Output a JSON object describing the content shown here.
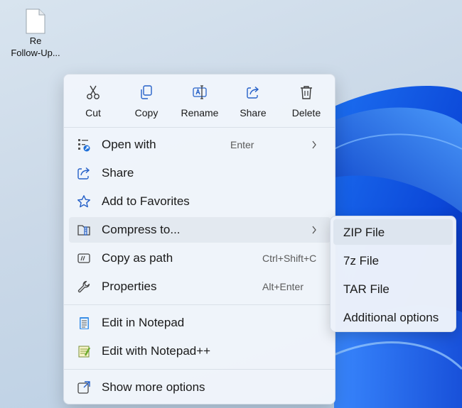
{
  "desktop": {
    "file_icon": {
      "label_line1": "Re",
      "label_line2": "Follow-Up..."
    }
  },
  "context_menu": {
    "quick_actions": [
      {
        "label": "Cut",
        "icon": "scissors-icon"
      },
      {
        "label": "Copy",
        "icon": "copy-icon"
      },
      {
        "label": "Rename",
        "icon": "rename-icon"
      },
      {
        "label": "Share",
        "icon": "share-icon"
      },
      {
        "label": "Delete",
        "icon": "trash-icon"
      }
    ],
    "items": [
      {
        "label": "Open with",
        "accelerator": "Enter",
        "has_submenu": true,
        "icon": "open-with-icon"
      },
      {
        "label": "Share",
        "accelerator": "",
        "icon": "share-icon"
      },
      {
        "label": "Add to Favorites",
        "accelerator": "",
        "icon": "star-icon"
      },
      {
        "label": "Compress to...",
        "accelerator": "",
        "has_submenu": true,
        "icon": "zip-folder-icon",
        "highlighted": true
      },
      {
        "label": "Copy as path",
        "accelerator": "Ctrl+Shift+C",
        "icon": "copy-path-icon"
      },
      {
        "label": "Properties",
        "accelerator": "Alt+Enter",
        "icon": "wrench-icon"
      },
      {
        "label": "Edit in Notepad",
        "accelerator": "",
        "icon": "notepad-icon"
      },
      {
        "label": "Edit with Notepad++",
        "accelerator": "",
        "icon": "notepad-plus-plus-icon"
      },
      {
        "label": "Show more options",
        "accelerator": "",
        "icon": "show-more-icon"
      }
    ]
  },
  "compress_submenu": {
    "items": [
      {
        "label": "ZIP File",
        "highlighted": true
      },
      {
        "label": "7z File"
      },
      {
        "label": "TAR File"
      },
      {
        "label": "Additional options"
      }
    ]
  }
}
